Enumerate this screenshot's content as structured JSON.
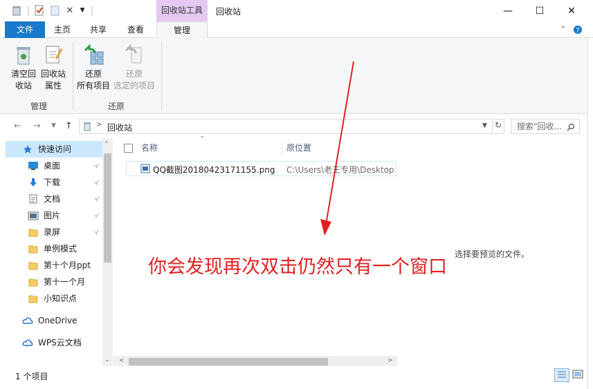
{
  "titlebar": {
    "context_tab": "回收站工具",
    "title": "回收站",
    "minimize": "—",
    "maximize": "☐",
    "close": "✕"
  },
  "tabs": {
    "file": "文件",
    "home": "主页",
    "share": "共享",
    "view": "查看",
    "manage": "管理"
  },
  "ribbon": {
    "empty_bin": [
      "清空回",
      "收站"
    ],
    "bin_props": [
      "回收站",
      "属性"
    ],
    "restore_all": [
      "还原",
      "所有项目"
    ],
    "restore_selected": [
      "还原",
      "选定的项目"
    ],
    "group_manage": "管理",
    "group_restore": "还原"
  },
  "address": {
    "path": "回收站",
    "search_placeholder": "搜索\"回收...",
    "refresh": "↻"
  },
  "navpane": {
    "items": [
      {
        "label": "快速访问",
        "icon": "star-icon",
        "pinned": false
      },
      {
        "label": "桌面",
        "icon": "desktop-icon",
        "pinned": true
      },
      {
        "label": "下载",
        "icon": "download-icon",
        "pinned": true
      },
      {
        "label": "文档",
        "icon": "document-icon",
        "pinned": true
      },
      {
        "label": "图片",
        "icon": "picture-icon",
        "pinned": true
      },
      {
        "label": "录屏",
        "icon": "folder-icon",
        "pinned": true
      },
      {
        "label": "单例模式",
        "icon": "folder-icon",
        "pinned": false
      },
      {
        "label": "第十个月ppt",
        "icon": "folder-icon",
        "pinned": false
      },
      {
        "label": "第十一个月",
        "icon": "folder-icon",
        "pinned": false
      },
      {
        "label": "小知识点",
        "icon": "folder-icon",
        "pinned": false
      },
      {
        "label": "OneDrive",
        "icon": "cloud-icon",
        "pinned": false
      },
      {
        "label": "WPS云文档",
        "icon": "cloud-icon",
        "pinned": false
      }
    ]
  },
  "filelist": {
    "col_name": "名称",
    "col_location": "原位置",
    "rows": [
      {
        "name": "QQ截图20180423171155.png",
        "location": "C:\\Users\\老王专用\\Desktop"
      }
    ]
  },
  "preview": {
    "message": "选择要预览的文件。"
  },
  "status": {
    "count": "1 个项目"
  },
  "annotation": {
    "text": "你会发现再次双击仍然只有一个窗口",
    "color": "#e02020"
  },
  "colors": {
    "file_tab": "#1979ca",
    "context_tab": "#e4c9f3",
    "ribbon_bg": "#f5f6f7"
  }
}
